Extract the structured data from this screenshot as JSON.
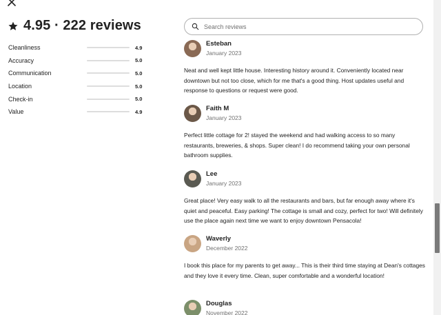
{
  "summary": {
    "title": "4.95 · 222 reviews"
  },
  "ratings": [
    {
      "label": "Cleanliness",
      "value": "4.9",
      "fraction": 0.98
    },
    {
      "label": "Accuracy",
      "value": "5.0",
      "fraction": 1.0
    },
    {
      "label": "Communication",
      "value": "5.0",
      "fraction": 1.0
    },
    {
      "label": "Location",
      "value": "5.0",
      "fraction": 1.0
    },
    {
      "label": "Check-in",
      "value": "5.0",
      "fraction": 1.0
    },
    {
      "label": "Value",
      "value": "4.9",
      "fraction": 0.98
    }
  ],
  "search": {
    "placeholder": "Search reviews"
  },
  "reviews": [
    {
      "name": "Esteban",
      "date": "January 2023",
      "text": "Neat and well kept little house. Interesting history around it. Conveniently located near downtown but not too close, which for me that's a good thing. Host updates useful and response to questions or request were good.",
      "avatar_color": "#8a6a55"
    },
    {
      "name": "Faith M",
      "date": "January 2023",
      "text": "Perfect little cottage for 2! stayed the weekend and had walking access to so many restaurants, breweries, & shops. Super clean! I do recommend taking your own personal bathroom supplies.",
      "avatar_color": "#6b5848"
    },
    {
      "name": "Lee",
      "date": "January 2023",
      "text": "Great place! Very easy walk to all the restaurants and bars, but far enough away where it's quiet and peaceful. Easy parking! The cottage is small and cozy, perfect for two! Will definitely use the place again next time we want to enjoy downtown Pensacola!",
      "avatar_color": "#5a5a52"
    },
    {
      "name": "Waverly",
      "date": "December 2022",
      "text": "I book this place for my parents to get away... This is their third time staying at Dean's cottages and they love it every time. Clean, super comfortable and a wonderful location!",
      "avatar_color": "#c9a583"
    },
    {
      "name": "Douglas",
      "date": "November 2022",
      "text": "",
      "avatar_color": "#7c8f6a"
    }
  ],
  "colors": {
    "text": "#222222",
    "muted": "#717171",
    "bar_track": "#dddddd",
    "bar_fill": "#222222"
  }
}
